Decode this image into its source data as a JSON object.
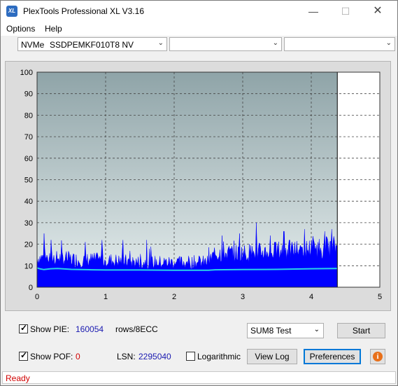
{
  "window": {
    "title": "PlexTools Professional XL V3.16",
    "icon_text": "XL"
  },
  "menu": {
    "items": [
      "Options",
      "Help"
    ]
  },
  "drive": {
    "type": "NVMe",
    "model": "SSDPEMKF010T8 NV",
    "combo2": "",
    "combo3": ""
  },
  "chart_data": {
    "type": "area",
    "x_ticks": [
      "0",
      "1",
      "2",
      "3",
      "4",
      "5"
    ],
    "y_ticks": [
      "0",
      "10",
      "20",
      "30",
      "40",
      "50",
      "60",
      "70",
      "80",
      "90",
      "100"
    ],
    "xlim": [
      0,
      5
    ],
    "ylim": [
      0,
      100
    ],
    "grid": true,
    "data_end_x": 4.38,
    "series": [
      {
        "kind": "bars",
        "color": "#0000ff",
        "baseline_values": [
          [
            0,
            13
          ],
          [
            0.3,
            13
          ],
          [
            0.6,
            12
          ],
          [
            1.0,
            12
          ],
          [
            1.5,
            11
          ],
          [
            2.0,
            11
          ],
          [
            2.5,
            11
          ],
          [
            2.6,
            15
          ],
          [
            3.0,
            15
          ],
          [
            3.5,
            16
          ],
          [
            4.0,
            17
          ],
          [
            4.38,
            18
          ]
        ],
        "peaks": [
          [
            0.1,
            25
          ],
          [
            0.2,
            22
          ],
          [
            0.7,
            21
          ],
          [
            0.95,
            22
          ],
          [
            1.25,
            22
          ],
          [
            1.6,
            22
          ],
          [
            2.7,
            24
          ],
          [
            2.95,
            25
          ],
          [
            3.2,
            30
          ],
          [
            3.4,
            24
          ],
          [
            3.6,
            26
          ],
          [
            3.9,
            27
          ],
          [
            4.0,
            22
          ],
          [
            4.2,
            26
          ],
          [
            4.3,
            27
          ]
        ]
      },
      {
        "kind": "line",
        "color": "#28d4e8",
        "points": [
          [
            0,
            9
          ],
          [
            0.05,
            8.5
          ],
          [
            0.1,
            8.2
          ],
          [
            0.2,
            8.6
          ],
          [
            0.3,
            8.7
          ],
          [
            0.5,
            8.3
          ],
          [
            0.8,
            8.1
          ],
          [
            1.0,
            8
          ],
          [
            1.5,
            8
          ],
          [
            2.0,
            7.9
          ],
          [
            2.5,
            7.9
          ],
          [
            2.6,
            8.1
          ],
          [
            3.0,
            8.2
          ],
          [
            3.5,
            8.3
          ],
          [
            4.0,
            8.6
          ],
          [
            4.38,
            8.7
          ]
        ]
      }
    ],
    "colors": {
      "plot_bg_top": "#8fa4a8",
      "plot_bg_bottom": "#e6eeee",
      "pie": "#0000ff",
      "avg": "#28d4e8"
    }
  },
  "controls": {
    "show_pie_label": "Show PIE:",
    "pie_value": "160054",
    "pie_unit": "rows/8ECC",
    "show_pof_label": "Show POF:",
    "pof_value": "0",
    "lsn_label": "LSN:",
    "lsn_value": "2295040",
    "logarithmic_label": "Logarithmic",
    "test_select": "SUM8 Test",
    "start_label": "Start",
    "view_log_label": "View Log",
    "preferences_label": "Preferences",
    "info_glyph": "i"
  },
  "status": {
    "text": "Ready"
  }
}
